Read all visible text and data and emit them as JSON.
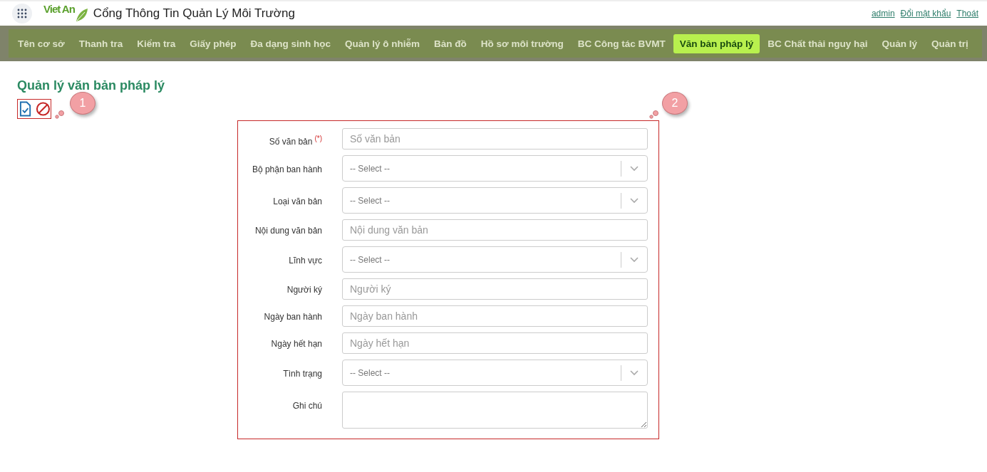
{
  "header": {
    "logo_text": "Viet An",
    "title": "Cổng Thông Tin Quản Lý Môi Trường",
    "user_links": [
      "admin",
      "Đổi mật khẩu",
      "Thoát"
    ]
  },
  "nav": [
    {
      "label": "Tên cơ sở",
      "selected": false
    },
    {
      "label": "Thanh tra",
      "selected": false
    },
    {
      "label": "Kiểm tra",
      "selected": false
    },
    {
      "label": "Giấy phép",
      "selected": false
    },
    {
      "label": "Đa dạng sinh học",
      "selected": false
    },
    {
      "label": "Quản lý ô nhiễm",
      "selected": false
    },
    {
      "label": "Bản đồ",
      "selected": false
    },
    {
      "label": "Hồ sơ môi trường",
      "selected": false
    },
    {
      "label": "BC Công tác BVMT",
      "selected": false
    },
    {
      "label": "Văn bản pháp lý",
      "selected": true
    },
    {
      "label": "BC Chất thải nguy hại",
      "selected": false
    },
    {
      "label": "Quản lý",
      "selected": false
    },
    {
      "label": "Quản trị",
      "selected": false
    }
  ],
  "page_title": "Quản lý văn bản pháp lý",
  "callouts": [
    "1",
    "2"
  ],
  "form": [
    {
      "kind": "text",
      "label": "Số văn bản",
      "required_mark": "(*)",
      "placeholder": "Số văn bản"
    },
    {
      "kind": "select",
      "label": "Bộ phận ban hành",
      "value": "-- Select --"
    },
    {
      "kind": "select",
      "label": "Loại văn bản",
      "value": "-- Select --"
    },
    {
      "kind": "text",
      "label": "Nội dung văn bản",
      "placeholder": "Nội dung văn bản"
    },
    {
      "kind": "select",
      "label": "Lĩnh vực",
      "value": "-- Select --"
    },
    {
      "kind": "text",
      "label": "Người ký",
      "placeholder": "Người ký"
    },
    {
      "kind": "text",
      "label": "Ngày ban hành",
      "placeholder": "Ngày ban hành"
    },
    {
      "kind": "text",
      "label": "Ngày hết hạn",
      "placeholder": "Ngày hết hạn"
    },
    {
      "kind": "select",
      "label": "Tình trạng",
      "value": "-- Select --"
    },
    {
      "kind": "textarea",
      "label": "Ghi chú"
    }
  ]
}
